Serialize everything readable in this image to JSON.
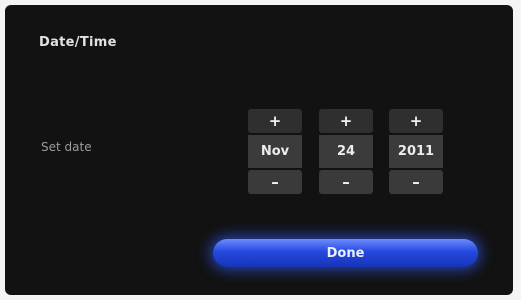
{
  "screen": {
    "title": "Date/Time"
  },
  "date_row": {
    "label": "Set date",
    "month": {
      "increment": "+",
      "value": "Nov",
      "decrement": "–"
    },
    "day": {
      "increment": "+",
      "value": "24",
      "decrement": "–"
    },
    "year": {
      "increment": "+",
      "value": "2011",
      "decrement": "–"
    }
  },
  "done_button": {
    "label": "Done"
  },
  "colors": {
    "background": "#121212",
    "control": "#3b3b3b",
    "accent": "#2549df"
  }
}
